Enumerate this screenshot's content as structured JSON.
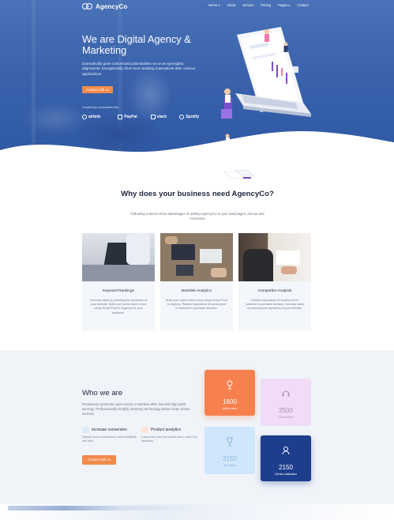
{
  "brand": {
    "name": "AgencyCo"
  },
  "nav": {
    "items": [
      "Home ▾",
      "About",
      "Service",
      "Pricing",
      "Pages ▾",
      "Contact"
    ]
  },
  "hero": {
    "title": "We are Digital Agency & Marketing",
    "subtitle": "Dramatically grow customized potentialities vis-a-vis synergistic alignments. Energistically drive team building imperatives after vertical applications.",
    "cta": "Contact with us",
    "trusted_label": "Trusted by companies like",
    "brands": [
      "airbnb",
      "PayPal",
      "slack",
      "Spotify"
    ]
  },
  "why": {
    "title": "Why does your business need AgencyCo?",
    "subtitle": "Following reasons show advantages of adding AgencyCo to your lead pages, demos and checkouts",
    "cards": [
      {
        "title": "Keyword Rankings",
        "text": "Increase sales by showing true dynamics of your website. Build your online store's trust using Social Proof & Urgency for your business."
      },
      {
        "title": "Backlink Analytics",
        "text": "Build your online store's trust using Social Proof & Urgency. Realize importance of social proof in customer's purchase decision."
      },
      {
        "title": "Competitor Analysis",
        "text": "Realize importance of social proof in customer's purchase decision. Increase sales by showing true dynamics of your website."
      }
    ]
  },
  "who": {
    "title": "Who we are",
    "description": "Proactively syndicate open-source e-markets after low-risk high-yield synergy. Professionally simplify visionary technology before team driven sources.",
    "features": [
      {
        "title": "Increase conversion",
        "text": "Display recent conversions, build credibility and trust."
      },
      {
        "title": "Product analytics",
        "text": "A top promo bar that counts down until a few discounts."
      }
    ],
    "cta": "Contact with us",
    "stats": [
      {
        "value": "1600",
        "label": "Active users",
        "icon": "user-pin-icon"
      },
      {
        "value": "2500",
        "label": "Global client",
        "icon": "headset-icon"
      },
      {
        "value": "2150",
        "label": "Win award",
        "icon": "trophy-icon"
      },
      {
        "value": "2150",
        "label": "Clients satisfaction",
        "icon": "user-icon"
      }
    ]
  },
  "colors": {
    "primary": "#2f58a3",
    "accent": "#f28a4a",
    "navy": "#1d3d8d"
  }
}
